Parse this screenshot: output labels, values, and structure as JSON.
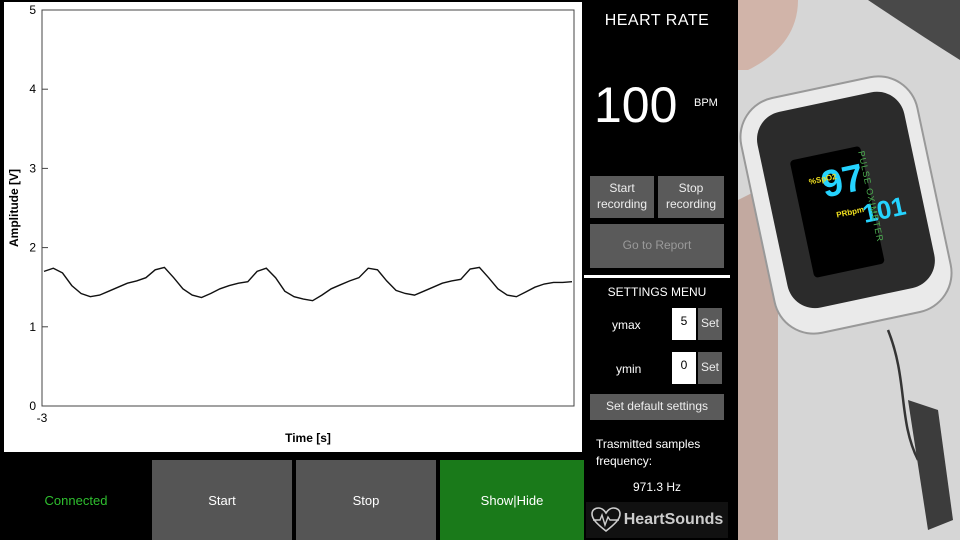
{
  "plot": {
    "ylabel": "Amplitude [V]",
    "xlabel": "Time [s]",
    "yticks": [
      "0",
      "1",
      "2",
      "3",
      "4",
      "5"
    ],
    "xtick": "-3"
  },
  "chart_data": {
    "type": "line",
    "xlabel": "Time [s]",
    "ylabel": "Amplitude [V]",
    "ylim": [
      0,
      5
    ],
    "grid": false,
    "series": [
      {
        "values": [
          1.7,
          1.74,
          1.68,
          1.52,
          1.42,
          1.38,
          1.4,
          1.45,
          1.5,
          1.55,
          1.58,
          1.62,
          1.72,
          1.75,
          1.62,
          1.48,
          1.4,
          1.37,
          1.42,
          1.48,
          1.52,
          1.55,
          1.57,
          1.7,
          1.74,
          1.62,
          1.45,
          1.38,
          1.35,
          1.33,
          1.4,
          1.48,
          1.53,
          1.58,
          1.62,
          1.74,
          1.72,
          1.58,
          1.46,
          1.42,
          1.4,
          1.45,
          1.5,
          1.55,
          1.58,
          1.6,
          1.73,
          1.75,
          1.62,
          1.48,
          1.4,
          1.38,
          1.44,
          1.5,
          1.54,
          1.56,
          1.56,
          1.57
        ]
      }
    ]
  },
  "bottom": {
    "status": "Connected",
    "start": "Start",
    "stop": "Stop",
    "showhide": "Show|Hide"
  },
  "side": {
    "hr_title": "HEART RATE",
    "hr_value": "100",
    "hr_unit": "BPM",
    "start_recording": "Start recording",
    "stop_recording": "Stop recording",
    "report": "Go to Report",
    "settings_title": "SETTINGS MENU",
    "ymax_label": "ymax",
    "ymax_value": "5",
    "ymin_label": "ymin",
    "ymin_value": "0",
    "set_label": "Set",
    "default_settings": "Set default settings",
    "freq_label": "Trasmitted samples frequency:",
    "freq_value": "971.3 Hz",
    "brand": "HeartSounds"
  },
  "oximeter": {
    "spo2": "97",
    "pr": "101",
    "spo2_label": "%SpO2",
    "pr_label": "PRbpm",
    "device_label": "PULSE OXIMETER"
  },
  "colors": {
    "status": "#2fbf2f",
    "showhide_bg": "#1a7a1a",
    "button": "#555555"
  }
}
